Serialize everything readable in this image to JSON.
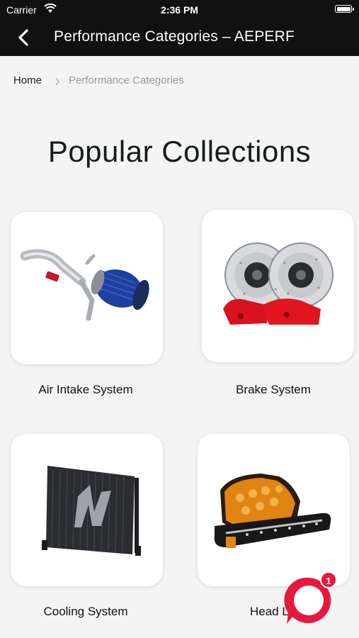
{
  "status_bar": {
    "carrier": "Carrier",
    "time": "2:36 PM"
  },
  "nav": {
    "title": "Performance Categories – AEPERF"
  },
  "breadcrumb": {
    "home": "Home",
    "separator": "›",
    "current": "Performance Categories"
  },
  "page_title": "Popular Collections",
  "collections": [
    {
      "label": "Air Intake System",
      "icon": "air-intake-image"
    },
    {
      "label": "Brake System",
      "icon": "brake-image"
    },
    {
      "label": "Cooling System",
      "icon": "radiator-image"
    },
    {
      "label": "Head Lig",
      "icon": "headlight-image"
    }
  ],
  "chat": {
    "badge_count": "1",
    "color": "#e8173d"
  }
}
